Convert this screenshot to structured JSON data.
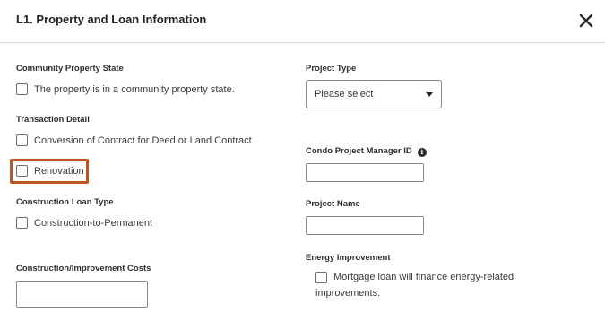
{
  "dialog": {
    "title": "L1. Property and Loan Information",
    "close_icon": "close-icon"
  },
  "community_property": {
    "label": "Community Property State",
    "checkbox_label": "The property is in a community property state.",
    "checked": false
  },
  "transaction_detail": {
    "label": "Transaction Detail",
    "options": [
      {
        "label": "Conversion of Contract for Deed or Land Contract",
        "checked": false
      },
      {
        "label": "Renovation",
        "checked": false
      }
    ]
  },
  "construction_loan_type": {
    "label": "Construction Loan Type",
    "checkbox_label": "Construction-to-Permanent",
    "checked": false
  },
  "construction_costs": {
    "label": "Construction/Improvement Costs",
    "value": ""
  },
  "project_type": {
    "label": "Project Type",
    "selected": "Please select"
  },
  "condo_manager": {
    "label": "Condo Project Manager ID",
    "info_icon": "info-icon",
    "info_glyph": "i",
    "value": ""
  },
  "project_name": {
    "label": "Project Name",
    "value": ""
  },
  "energy_improvement": {
    "label": "Energy Improvement",
    "line1": "Mortgage loan will finance energy-related",
    "line2": "improvements.",
    "checked": false
  },
  "colors": {
    "highlight": "#c0541a",
    "border": "#8a8a8a",
    "text": "#3a3a3a"
  }
}
